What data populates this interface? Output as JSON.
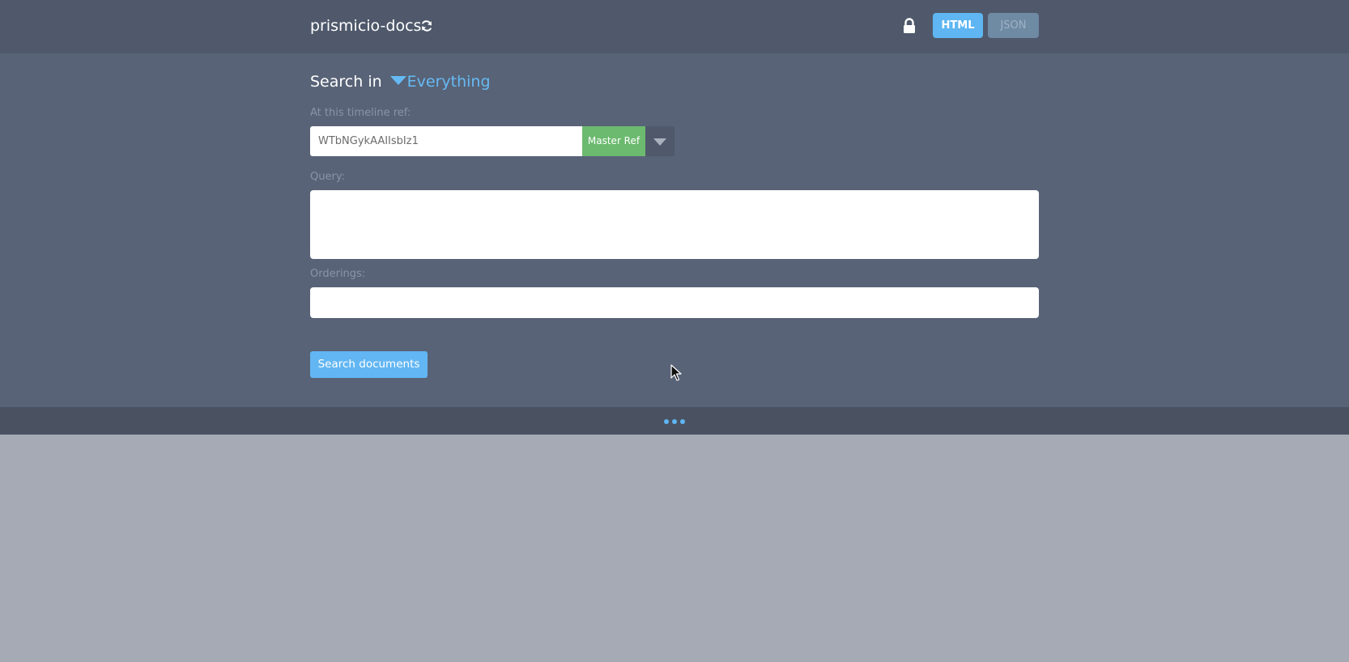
{
  "header": {
    "app_title": "prismicio-docs",
    "refresh_icon": "refresh-icon",
    "lock_icon": "lock-icon",
    "format_buttons": [
      {
        "label": "HTML",
        "active": true
      },
      {
        "label": "JSON",
        "active": false
      }
    ]
  },
  "search": {
    "prefix": "Search in",
    "scope": "Everything",
    "ref_label": "At this timeline ref:",
    "ref_value": "WTbNGykAAIIsbIz1",
    "master_ref_label": "Master Ref",
    "query_label": "Query:",
    "query_value": "",
    "orderings_label": "Orderings:",
    "orderings_value": "",
    "submit_label": "Search documents"
  },
  "colors": {
    "accent": "#5fb6f3",
    "master_ref": "#6cba6f",
    "topbar": "#4f596b",
    "panel": "#586377",
    "lower": "#a6aab5"
  }
}
